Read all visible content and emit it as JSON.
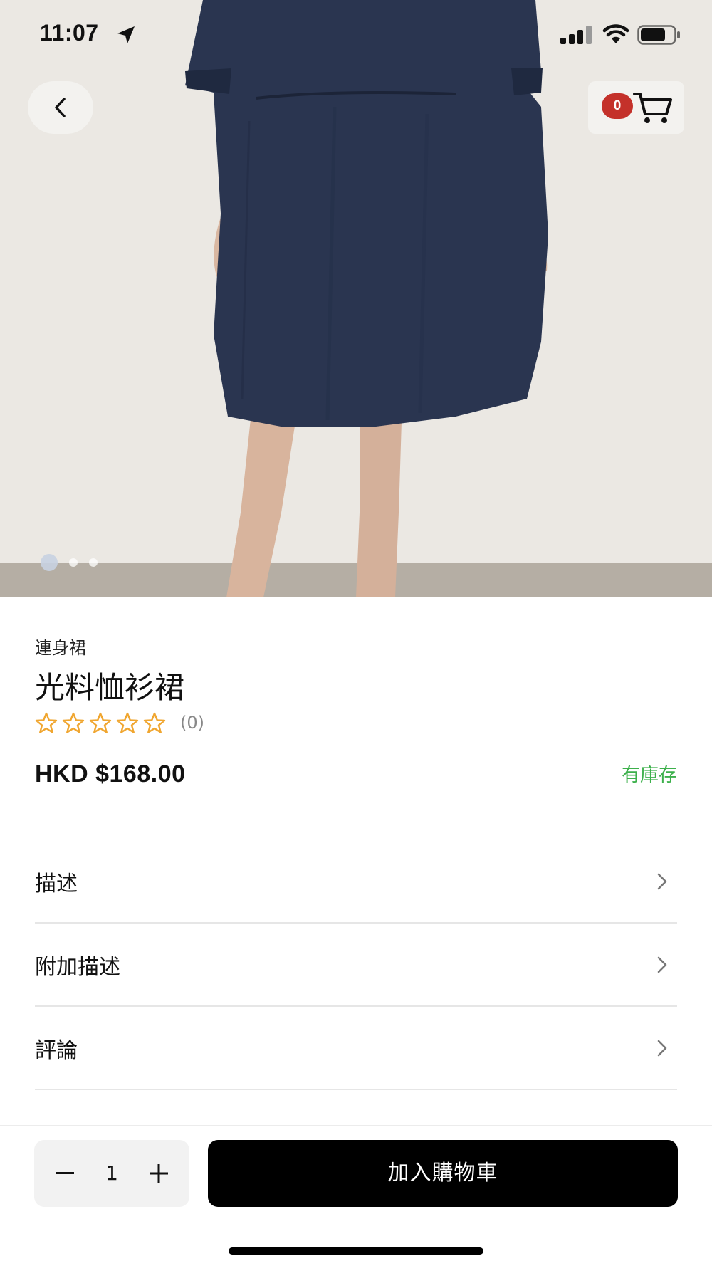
{
  "status_bar": {
    "time": "11:07"
  },
  "header": {
    "cart_count": "0"
  },
  "gallery": {
    "image_count": 3,
    "active_index": 0
  },
  "product": {
    "category": "連身裙",
    "title": "光料恤衫裙",
    "rating": {
      "stars": 0,
      "max_stars": 5,
      "count_label": "(0)"
    },
    "price": "HKD $168.00",
    "stock_status": "有庫存"
  },
  "sections": [
    {
      "label": "描述"
    },
    {
      "label": "附加描述"
    },
    {
      "label": "評論"
    }
  ],
  "purchase": {
    "quantity": "1",
    "add_to_cart_label": "加入購物車"
  },
  "colors": {
    "badge": "#c4312a",
    "stock": "#3cb04b",
    "star": "#f0a630",
    "primary_button": "#000000"
  },
  "icons": {
    "back": "chevron-left-icon",
    "cart": "shopping-cart-icon",
    "row_arrow": "chevron-right-icon",
    "minus": "minus-icon",
    "plus": "plus-icon",
    "star": "star-outline-icon"
  }
}
